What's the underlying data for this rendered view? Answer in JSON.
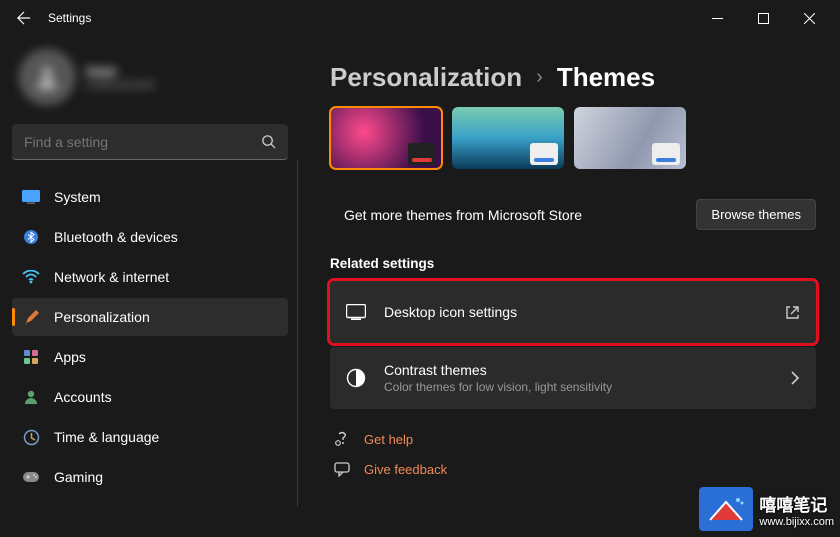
{
  "window": {
    "title": "Settings"
  },
  "profile": {
    "name": "User",
    "sub": "Local Account"
  },
  "search": {
    "placeholder": "Find a setting"
  },
  "nav": [
    {
      "label": "System"
    },
    {
      "label": "Bluetooth & devices"
    },
    {
      "label": "Network & internet"
    },
    {
      "label": "Personalization"
    },
    {
      "label": "Apps"
    },
    {
      "label": "Accounts"
    },
    {
      "label": "Time & language"
    },
    {
      "label": "Gaming"
    }
  ],
  "breadcrumb": {
    "parent": "Personalization",
    "current": "Themes"
  },
  "store": {
    "text": "Get more themes from Microsoft Store",
    "button": "Browse themes"
  },
  "section": {
    "related": "Related settings"
  },
  "cards": {
    "desktopIcons": {
      "title": "Desktop icon settings"
    },
    "contrast": {
      "title": "Contrast themes",
      "sub": "Color themes for low vision, light sensitivity"
    }
  },
  "links": {
    "help": "Get help",
    "feedback": "Give feedback"
  },
  "watermark": {
    "text": "嘻嘻笔记",
    "url": "www.bijixx.com"
  }
}
